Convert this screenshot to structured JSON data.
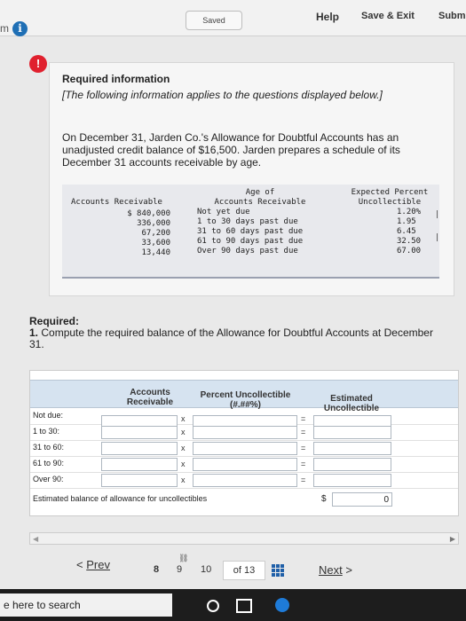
{
  "topbar": {
    "fragment": "m",
    "saved": "Saved",
    "help": "Help",
    "save_exit": "Save & Exit",
    "submit": "Subm"
  },
  "info": {
    "required_info_title": "Required information",
    "note": "[The following information applies to the questions displayed below.]",
    "paragraph": "On December 31, Jarden Co.'s Allowance for Doubtful Accounts has an unadjusted credit balance of $16,500. Jarden prepares a schedule of its December 31 accounts receivable by age."
  },
  "aging_table": {
    "col1_header": "Accounts Receivable",
    "col2_header": [
      "Age of",
      "Accounts Receivable"
    ],
    "col3_header": [
      "Expected Percent",
      "Uncollectible"
    ],
    "rows": [
      {
        "amount": "$ 840,000",
        "age": "Not yet due",
        "pct": "1.20%"
      },
      {
        "amount": "336,000",
        "age": "1 to 30 days past due",
        "pct": "1.95"
      },
      {
        "amount": "67,200",
        "age": "31 to 60 days past due",
        "pct": "6.45"
      },
      {
        "amount": "33,600",
        "age": "61 to 90 days past due",
        "pct": "32.50"
      },
      {
        "amount": "13,440",
        "age": "Over 90 days past due",
        "pct": "67.00"
      }
    ]
  },
  "question": {
    "required_label": "Required:",
    "number": "1.",
    "text": "Compute the required balance of the Allowance for Doubtful Accounts at December 31."
  },
  "answer_table": {
    "header_ar": "Accounts Receivable",
    "header_pct": "Percent Uncollectible (#.##%)",
    "header_est": "Estimated Uncollectible",
    "operator_times": "x",
    "operator_equals": "=",
    "rows": [
      {
        "label": "Not due:"
      },
      {
        "label": "1 to 30:"
      },
      {
        "label": "31 to 60:"
      },
      {
        "label": "61 to 90:"
      },
      {
        "label": "Over 90:"
      }
    ],
    "footer_label": "Estimated balance of allowance for uncollectibles",
    "footer_currency": "$",
    "footer_value": "0"
  },
  "navigation": {
    "prev": "Prev",
    "page_8": "8",
    "page_9": "9",
    "page_10": "10",
    "page_of": "of 13",
    "next": "Next"
  },
  "taskbar": {
    "search_text": "e here to search"
  }
}
